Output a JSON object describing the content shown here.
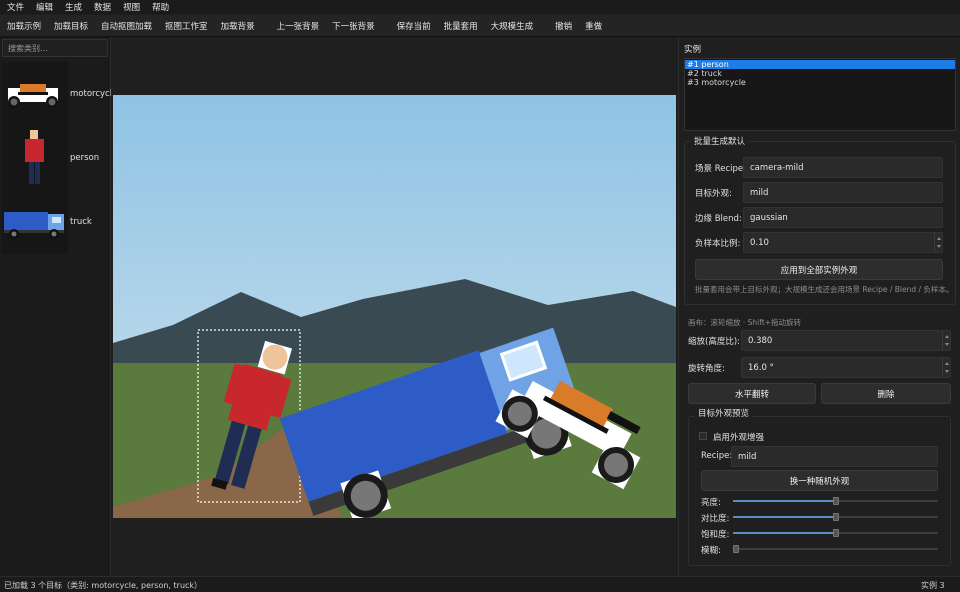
{
  "menu": [
    "文件",
    "编辑",
    "生成",
    "数据",
    "视图",
    "帮助"
  ],
  "toolbar": [
    {
      "label": "加载示例"
    },
    {
      "label": "加载目标"
    },
    {
      "label": "自动抠图加载"
    },
    {
      "label": "抠图工作室"
    },
    {
      "label": "加载背景",
      "gap": true
    },
    {
      "label": "上一张背景"
    },
    {
      "label": "下一张背景",
      "gap": true
    },
    {
      "label": "保存当前"
    },
    {
      "label": "批量套用"
    },
    {
      "label": "大规模生成",
      "gap": true
    },
    {
      "label": "撤销"
    },
    {
      "label": "重做"
    }
  ],
  "left": {
    "search_placeholder": "搜索类别...",
    "categories": [
      "motorcycle",
      "person",
      "truck"
    ]
  },
  "right": {
    "instances_title": "实例",
    "instances": [
      "#1  person",
      "#2  truck",
      "#3  motorcycle"
    ],
    "batch_title": "批量生成默认",
    "scene_label": "场景 Recipe:",
    "scene_value": "camera-mild",
    "target_label": "目标外观:",
    "target_value": "mild",
    "edge_label": "边缘 Blend:",
    "edge_value": "gaussian",
    "neg_label": "负样本比例:",
    "neg_value": "0.10",
    "apply_all": "应用到全部实例外观",
    "batch_hint": "批量套用会带上目标外观；大规模生成还会用场景 Recipe / Blend / 负样本。",
    "canvas_hint": "画布：滚轮缩放 · Shift+拖动旋转",
    "scale_label": "缩放(高度比):",
    "scale_value": "0.380",
    "rot_label": "旋转角度:",
    "rot_value": "16.0 °",
    "flip": "水平翻转",
    "delete": "删除",
    "preview_title": "目标外观预览",
    "enable_aug": "启用外观增强",
    "recipe_label": "Recipe:",
    "recipe_value": "mild",
    "random_btn": "换一种随机外观",
    "sliders": [
      {
        "label": "亮度:",
        "fraction": 0.5
      },
      {
        "label": "对比度:",
        "fraction": 0.5
      },
      {
        "label": "饱和度:",
        "fraction": 0.5
      },
      {
        "label": "模糊:",
        "fraction": 0.0
      }
    ]
  },
  "status": {
    "left": "已加载 3 个目标（类别: motorcycle, person, truck）",
    "right": "实例 3"
  },
  "colors": {
    "accent": "#1e7ce6",
    "sky": "#9cc9e6",
    "grass": "#5a7a3e",
    "mountain": "#3a4a52",
    "truck_blue": "#2e5cc6"
  }
}
